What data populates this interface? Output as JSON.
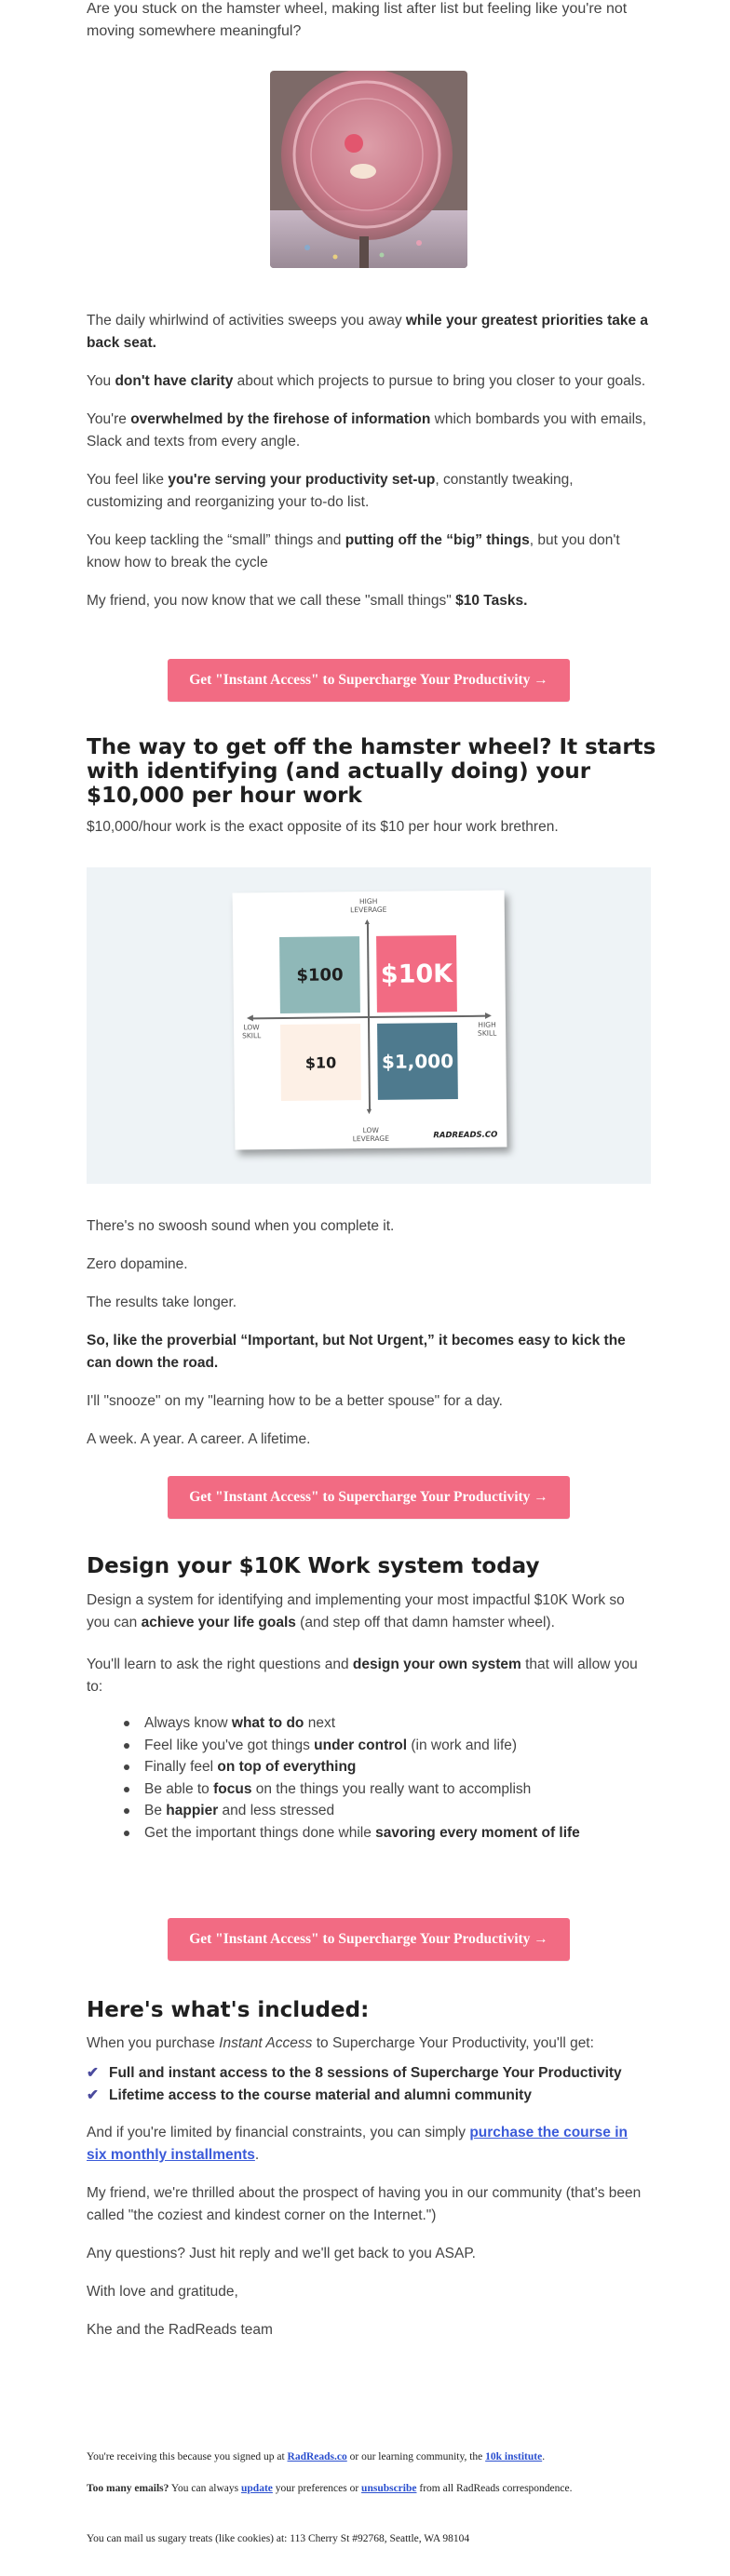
{
  "intro": {
    "question": "Are you stuck on the hamster wheel, making list after list but feeling like you're not moving somewhere meaningful?"
  },
  "problems": {
    "p1_a": "The daily whirlwind of activities sweeps you away ",
    "p1_b": "while your greatest priorities take a back seat.",
    "p2_a": "You ",
    "p2_b": "don't have clarity",
    "p2_c": " about which projects to pursue to bring you closer to your goals.",
    "p3_a": "You're ",
    "p3_b": "overwhelmed by the firehose of information",
    "p3_c": " which bombards you with emails, Slack and texts from every angle.",
    "p4_a": "You feel like ",
    "p4_b": "you're serving your productivity set-up",
    "p4_c": ", constantly tweaking, customizing and reorganizing your to-do list.",
    "p5_a": "You keep tackling the “small” things and ",
    "p5_b": "putting off the “big” things",
    "p5_c": ", but you don't know how to break the cycle",
    "p6_a": "My friend, you now know that we call these \"small things\" ",
    "p6_b": "$10 Tasks."
  },
  "cta_label": "Get \"Instant Access\" to Supercharge Your Productivity →",
  "section1": {
    "heading": "The way to get off the hamster wheel? It starts with identifying (and actually doing) your $10,000 per hour work",
    "sub": "$10,000/hour work is the exact opposite of its $10 per hour work brethren."
  },
  "matrix": {
    "top_label": "HIGH\nLEVERAGE",
    "bottom_label": "LOW\nLEVERAGE",
    "left_label": "LOW\nSKILL",
    "right_label": "HIGH\nSKILL",
    "tile_100": "$100",
    "tile_10k": "$10K",
    "tile_10": "$10",
    "tile_1000": "$1,000",
    "brand": "RADREADS.CO",
    "colors": {
      "teal": "#8fb8b8",
      "pink": "#f26b83",
      "cream": "#fdf0e6",
      "slate": "#4e7a8e"
    }
  },
  "section2": {
    "l1": "There's no swoosh sound when you complete it.",
    "l2": "Zero dopamine.",
    "l3": "The results take longer.",
    "l4": "So, like the proverbial “Important, but Not Urgent,” it becomes easy to kick the can down the road.",
    "l5": "I'll \"snooze\" on my \"learning how to be a better spouse\" for a day.",
    "l6": "A week. A year. A career. A lifetime."
  },
  "section3": {
    "heading": "Design your $10K Work system today",
    "p1_a": "Design a system for identifying and implementing your most impactful $10K Work so you can ",
    "p1_b": "achieve your life goals",
    "p1_c": " (and step off that damn hamster wheel).",
    "p2_a": "You'll learn to ask the right questions and ",
    "p2_b": "design your own system",
    "p2_c": " that will allow you to:",
    "bullets": [
      {
        "a": "Always know ",
        "b": "what to do",
        "c": " next"
      },
      {
        "a": "Feel like you've got things ",
        "b": "under control",
        "c": " (in work and life)"
      },
      {
        "a": "Finally feel ",
        "b": "on top of everything",
        "c": ""
      },
      {
        "a": "Be able to ",
        "b": "focus",
        "c": " on the things you really want to accomplish"
      },
      {
        "a": "Be ",
        "b": "happier",
        "c": " and less stressed"
      },
      {
        "a": "Get the important things done while ",
        "b": "savoring every moment of life",
        "c": ""
      }
    ]
  },
  "section4": {
    "heading": "Here's what's included:",
    "p1_a": "When you purchase ",
    "p1_b": "Instant Access",
    "p1_c": " to Supercharge Your Productivity, you'll get:",
    "check1": "Full and instant access to the 8 sessions of Supercharge Your Productivity",
    "check2": "Lifetime access to the course material and alumni community",
    "p2_a": "And if you're limited by financial constraints, you can simply ",
    "p2_link": "purchase the course in six monthly installments",
    "p2_c": ".",
    "p3": "My friend, we're thrilled about the prospect of having you in our community (that's been called \"the coziest and kindest corner on the Internet.\")",
    "p4": "Any questions? Just hit reply and we'll get back to you ASAP.",
    "p5": "With love and gratitude,",
    "p6": "Khe and the RadReads team"
  },
  "footer": {
    "f1_a": "You're receiving this because you signed up at ",
    "f1_link1": "RadReads.co",
    "f1_b": " or our learning community, the ",
    "f1_link2": "10k institute",
    "f1_c": ".",
    "f2_bold": "Too many emails?",
    "f2_a": " You can always ",
    "f2_link1": "update",
    "f2_b": " your preferences or ",
    "f2_link2": "unsubscribe",
    "f2_c": " from all RadReads correspondence.",
    "f3": "You can mail us sugary treats (like cookies) at: 113 Cherry St #92768, Seattle, WA 98104"
  }
}
